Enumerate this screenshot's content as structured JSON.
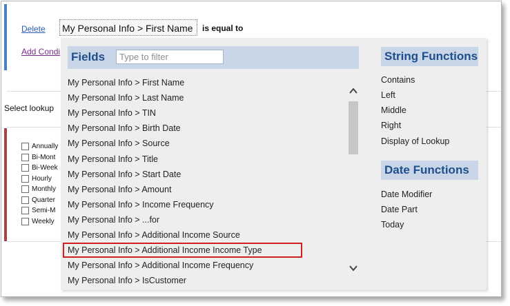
{
  "condition": {
    "delete_label": "Delete",
    "add_condition_label": "Add Condi",
    "field_value": "My Personal Info > First Name",
    "operator": "is equal to"
  },
  "lookup": {
    "label": "Select lookup",
    "options": [
      "Annually",
      "Bi-Mont",
      "Bi-Week",
      "Hourly",
      "Monthly",
      "Quarter",
      "Semi-M",
      "Weekly"
    ]
  },
  "fields_panel": {
    "title": "Fields",
    "filter_placeholder": "Type to filter",
    "items": [
      "My Personal Info > First Name",
      "My Personal Info > Last Name",
      "My Personal Info > TIN",
      "My Personal Info > Birth Date",
      "My Personal Info > Source",
      "My Personal Info > Title",
      "My Personal Info > Start Date",
      "My Personal Info > Amount",
      "My Personal Info > Income Frequency",
      "My Personal Info > ...for",
      "My Personal Info > Additional Income Source",
      "My Personal Info > Additional Income Income Type",
      "My Personal Info > Additional Income Frequency",
      "My Personal Info > IsCustomer"
    ],
    "highlighted_item": "My Personal Info > Additional Income Income Type",
    "highlight_color": "#d11f1f"
  },
  "string_functions": {
    "title": "String Functions",
    "items": [
      "Contains",
      "Left",
      "Middle",
      "Right",
      "Display of Lookup"
    ]
  },
  "date_functions": {
    "title": "Date Functions",
    "items": [
      "Date Modifier",
      "Date Part",
      "Today"
    ]
  },
  "icons": {
    "scroll_up": "chevron-up-icon",
    "scroll_down": "chevron-down-icon"
  },
  "colors": {
    "header_bg": "#c8d6e8",
    "header_text": "#1f4e8c",
    "popup_bg": "#eeeeee",
    "condition_bar": "#4a7fc1",
    "lookup_bar": "#a04545"
  }
}
